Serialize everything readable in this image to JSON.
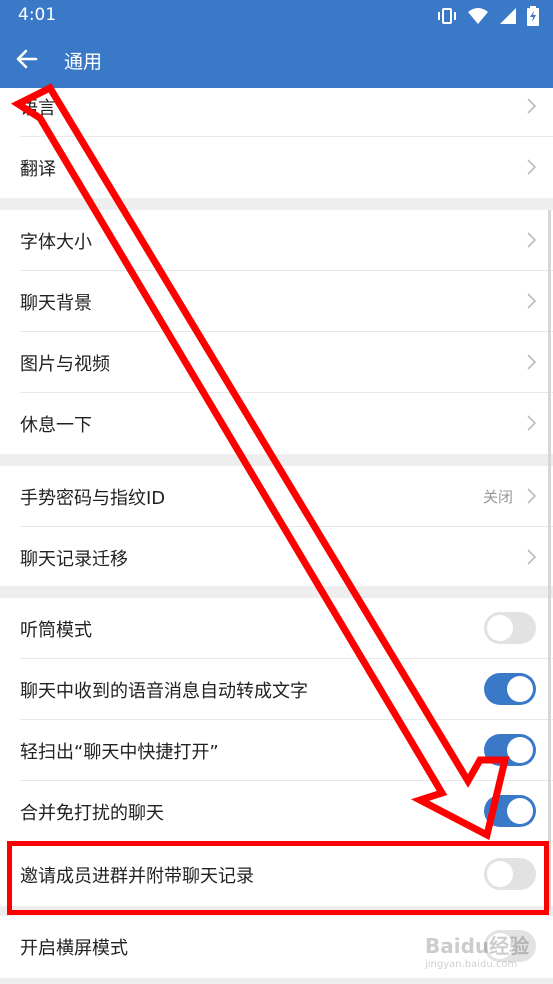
{
  "status": {
    "time": "4:01"
  },
  "appbar": {
    "title": "通用"
  },
  "groups": [
    {
      "items": [
        {
          "label": "语言",
          "control": "chevron"
        },
        {
          "label": "翻译",
          "control": "chevron"
        }
      ]
    },
    {
      "items": [
        {
          "label": "字体大小",
          "control": "chevron"
        },
        {
          "label": "聊天背景",
          "control": "chevron"
        },
        {
          "label": "图片与视频",
          "control": "chevron"
        },
        {
          "label": "休息一下",
          "control": "chevron"
        }
      ]
    },
    {
      "items": [
        {
          "label": "手势密码与指纹ID",
          "value": "关闭",
          "control": "chevron"
        },
        {
          "label": "聊天记录迁移",
          "control": "chevron"
        }
      ]
    },
    {
      "items": [
        {
          "label": "听筒模式",
          "control": "toggle",
          "state": "off"
        },
        {
          "label": "聊天中收到的语音消息自动转成文字",
          "control": "toggle",
          "state": "on"
        },
        {
          "label": "轻扫出“聊天中快捷打开”",
          "control": "toggle",
          "state": "on"
        },
        {
          "label": "合并免打扰的聊天",
          "control": "toggle",
          "state": "on"
        },
        {
          "label": "邀请成员进群并附带聊天记录",
          "control": "toggle",
          "state": "off"
        }
      ]
    },
    {
      "items": [
        {
          "label": "开启横屏模式",
          "control": "toggle",
          "state": "off"
        }
      ]
    }
  ],
  "watermark": {
    "brand": "Baidu经验",
    "sub": "jingyan.baidu.com"
  },
  "colors": {
    "primary": "#3a78c8",
    "annotation": "#ff0000",
    "background": "#eeeeee"
  },
  "icons": {
    "back": "arrow-left-icon",
    "chevron": "chevron-right-icon",
    "vibrate": "vibrate-icon",
    "wifi": "wifi-icon",
    "battery": "battery-charging-icon"
  }
}
